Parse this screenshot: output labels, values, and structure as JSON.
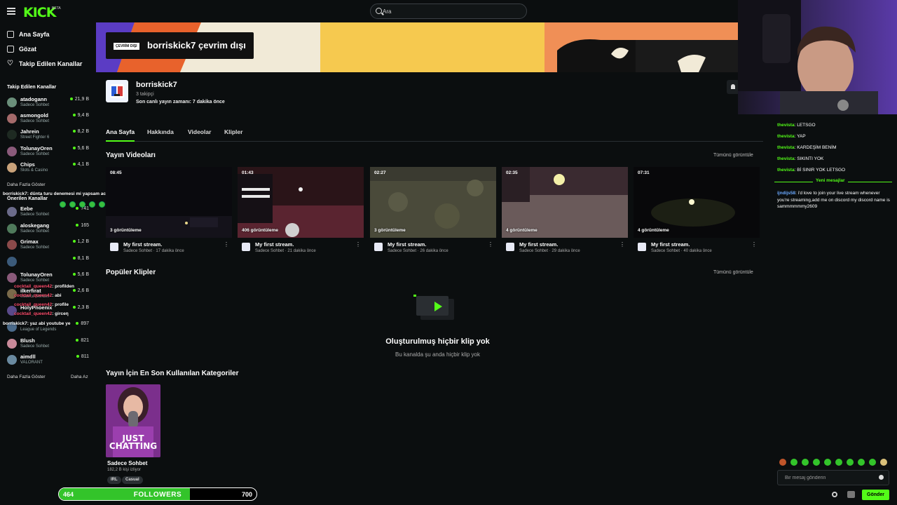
{
  "app": {
    "logo": "KICK",
    "logo_badge": "BETA"
  },
  "search": {
    "placeholder": "Ara"
  },
  "nav": {
    "home": "Ana Sayfa",
    "browse": "Gözat",
    "following": "Takip Edilen Kanallar"
  },
  "followed_title": "Takip Edilen Kanallar",
  "followed": [
    {
      "name": "atadogann",
      "category": "Sadece Sohbet",
      "viewers": "21,9 B"
    },
    {
      "name": "asmongold",
      "category": "Sadece Sohbet",
      "viewers": "9,4 B"
    },
    {
      "name": "Jahrein",
      "category": "Street Fighter 6",
      "viewers": "8,2 B"
    },
    {
      "name": "TolunayOren",
      "category": "Sadece Sohbet",
      "viewers": "5,6 B"
    },
    {
      "name": "Chips",
      "category": "Slots & Casino",
      "viewers": "4,1 B"
    }
  ],
  "show_more": "Daha Fazla Göster",
  "show_less": "Daha Az",
  "recommended_title": "Önerilen Kanallar",
  "recommended": [
    {
      "name": "Eebe",
      "category": "Sadece Sohbet",
      "viewers": "741"
    },
    {
      "name": "aloskegang",
      "category": "Sadece Sohbet",
      "viewers": "165"
    },
    {
      "name": "Grimax",
      "category": "Sadece Sohbet",
      "viewers": "1,2 B"
    },
    {
      "name": "",
      "category": "",
      "viewers": "8,1 B"
    },
    {
      "name": "TolunayOren",
      "category": "Sadece Sohbet",
      "viewers": "5,6 B"
    },
    {
      "name": "ilkerfirat",
      "category": "Sadece Sohbet",
      "viewers": "2,6 B"
    },
    {
      "name": "HolyPhoenix",
      "category": "",
      "viewers": "2,3 B"
    },
    {
      "name": "",
      "category": "League of Legends",
      "viewers": "897"
    },
    {
      "name": "Blush",
      "category": "Sadece Sohbet",
      "viewers": "821"
    },
    {
      "name": "aimdll",
      "category": "VALORANT",
      "viewers": "811"
    }
  ],
  "overlay_chat": [
    {
      "user": "borriskick7",
      "text": ": dünta turu denemesi mi yapsam acaba"
    },
    {
      "user": "cocktail_queen42",
      "text": ": profilden"
    },
    {
      "user": "cocktail_queen42",
      "text": ": abi"
    },
    {
      "user": "cocktail_queen42",
      "text": ": profile"
    },
    {
      "user": "cocktail_queen42",
      "text": ": girceη"
    },
    {
      "user": "borriskick7",
      "text": ": yaz abi youtube ye"
    }
  ],
  "channel": {
    "offline_badge": "ÇEVRİM DIŞI",
    "offline_title": "borriskick7 çevrim dışı",
    "name": "borriskick7",
    "followers": "3 takipçi",
    "last_live": "Son canlı yayın zamanı: 7 dakika önce"
  },
  "tabs": [
    "Ana Sayfa",
    "Hakkında",
    "Videolar",
    "Klipler"
  ],
  "sections": {
    "videos": "Yayın Videoları",
    "clips": "Popüler Klipler",
    "categories": "Yayın İçin En Son Kullanılan Kategoriler",
    "see_all": "Tümünü görüntüle"
  },
  "videos": [
    {
      "duration": "08:45",
      "views": "3 görüntüleme",
      "title": "My first stream.",
      "meta": "Sadece Sohbet · 17 dakika önce"
    },
    {
      "duration": "01:43",
      "views": "406 görüntüleme",
      "title": "My first stream.",
      "meta": "Sadece Sohbet · 21 dakika önce"
    },
    {
      "duration": "02:27",
      "views": "3 görüntüleme",
      "title": "My first stream.",
      "meta": "Sadece Sohbet · 26 dakika önce"
    },
    {
      "duration": "02:35",
      "views": "4 görüntüleme",
      "title": "My first stream.",
      "meta": "Sadece Sohbet · 29 dakika önce"
    },
    {
      "duration": "07:31",
      "views": "4 görüntüleme",
      "title": "My first stream.",
      "meta": "Sadece Sohbet · 40 dakika önce"
    }
  ],
  "empty_clips": {
    "title": "Oluşturulmuş hiçbir klip yok",
    "subtitle": "Bu kanalda şu anda hiçbir klip yok"
  },
  "category": {
    "art": "JUST CHATTING",
    "name": "Sadece Sohbet",
    "viewers": "182,2 B kişi izliyor",
    "tags": [
      "IRL",
      "Casual"
    ]
  },
  "follower_goal": {
    "current": "464",
    "label": "FOLLOWERS",
    "goal": "700",
    "progress": 0.663
  },
  "chat": {
    "messages": [
      {
        "user": "thevista",
        "text": ": LETSGO"
      },
      {
        "user": "thevista",
        "text": ": YAP"
      },
      {
        "user": "thevista",
        "text": ": KARDEŞİM BENİM"
      },
      {
        "user": "thevista",
        "text": ": SIKINTI YOK"
      },
      {
        "user": "thevista",
        "text": ": Bİ SINIR YOK LETSGO"
      }
    ],
    "new_messages": "Yeni mesajlar",
    "after": {
      "user": "ijndijs58",
      "text": ": i'd love to join your live stream whenever you're streaming,add me on discord my discord name is sammmmmmy2609"
    },
    "input_placeholder": "Bir mesaj gönderin",
    "send": "Gönder"
  }
}
